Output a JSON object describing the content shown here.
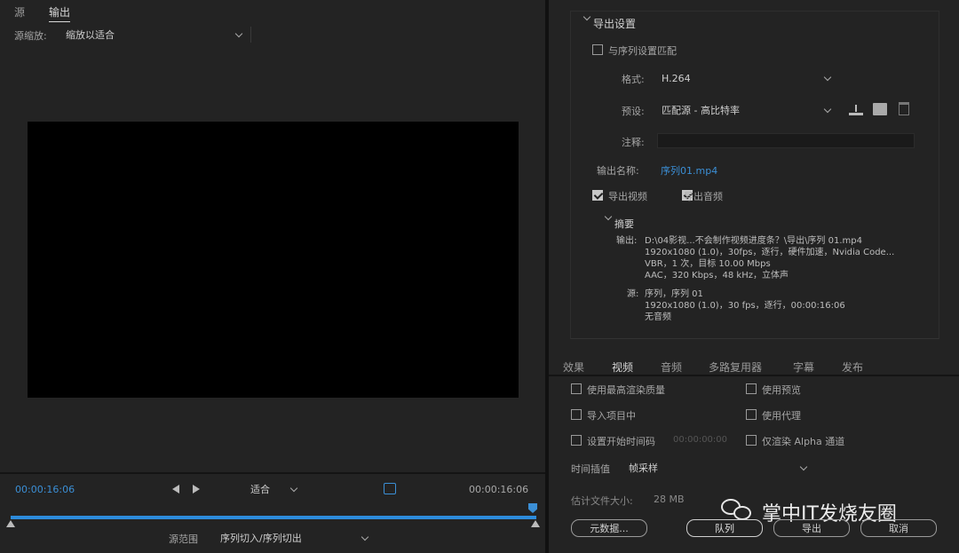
{
  "left": {
    "tabs": [
      "源",
      "输出"
    ],
    "source_scaling_label": "源缩放:",
    "source_scaling_value": "缩放以适合",
    "timecode_start": "00:00:16:06",
    "timecode_end": "00:00:16:06",
    "fit_value": "适合",
    "range_label": "源范围",
    "range_value": "序列切入/序列切出"
  },
  "right": {
    "section_title": "导出设置",
    "match_sequence_label": "与序列设置匹配",
    "format_label": "格式:",
    "format_value": "H.264",
    "preset_label": "预设:",
    "preset_value": "匹配源 - 高比特率",
    "comment_label": "注释:",
    "output_name_label": "输出名称:",
    "output_name_value": "序列01.mp4",
    "export_video_label": "导出视频",
    "export_audio_label": "导出音频",
    "summary_title": "摘要",
    "summary_output_label": "输出:",
    "summary_output_lines": [
      "D:\\04影视...不会制作视频进度条？\\导出\\序列 01.mp4",
      "1920x1080 (1.0)，30fps，逐行，硬件加速，Nvidia Code...",
      "VBR，1 次，目标 10.00 Mbps",
      "AAC，320 Kbps，48 kHz，立体声"
    ],
    "summary_source_label": "源:",
    "summary_source_lines": [
      "序列，序列 01",
      "1920x1080 (1.0)，30 fps，逐行，00:00:16:06",
      "无音频"
    ],
    "tabs": [
      "效果",
      "视频",
      "音频",
      "多路复用器",
      "字幕",
      "发布"
    ],
    "options": {
      "max_render_quality": "使用最高渲染质量",
      "use_previews": "使用预览",
      "import_into_project": "导入项目中",
      "use_proxies": "使用代理",
      "set_start_timecode": "设置开始时间码",
      "start_timecode_value": "00:00:00:00",
      "render_alpha_only": "仅渲染 Alpha 通道"
    },
    "time_interpolation_label": "时间插值",
    "time_interpolation_value": "帧采样",
    "file_size_label": "估计文件大小:",
    "file_size_value": "28 MB",
    "buttons": {
      "metadata": "元数据...",
      "queue": "队列",
      "export": "导出",
      "cancel": "取消"
    },
    "watermark_text": "掌中IT发烧友圈"
  },
  "colors": {
    "accent": "#2d8bdb",
    "panel": "#232323",
    "preview": "#000000"
  }
}
